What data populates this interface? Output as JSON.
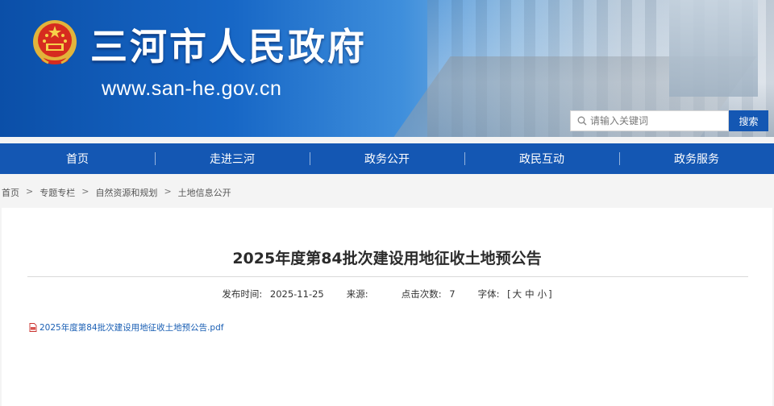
{
  "header": {
    "site_title": "三河市人民政府",
    "site_url": "www.san-he.gov.cn",
    "search": {
      "placeholder": "请输入关键词",
      "button_label": "搜索"
    }
  },
  "nav": {
    "items": [
      {
        "label": "首页"
      },
      {
        "label": "走进三河"
      },
      {
        "label": "政务公开"
      },
      {
        "label": "政民互动"
      },
      {
        "label": "政务服务"
      }
    ]
  },
  "breadcrumb": {
    "items": [
      "首页",
      "专题专栏",
      "自然资源和规划",
      "土地信息公开"
    ],
    "separator": ">"
  },
  "article": {
    "title": "2025年度第84批次建设用地征收土地预公告",
    "meta": {
      "publish_label": "发布时间:",
      "publish_date": "2025-11-25",
      "source_label": "来源:",
      "source_value": "",
      "clicks_label": "点击次数:",
      "clicks_value": "7",
      "font_label": "字体:",
      "font_open": "[",
      "font_large": "大",
      "font_medium": "中",
      "font_small": "小",
      "font_close": "]"
    },
    "attachment": {
      "filename": "2025年度第84批次建设用地征收土地预公告.pdf",
      "icon": "pdf-icon"
    }
  },
  "colors": {
    "primary": "#1457b3",
    "link": "#1a5fb4"
  }
}
